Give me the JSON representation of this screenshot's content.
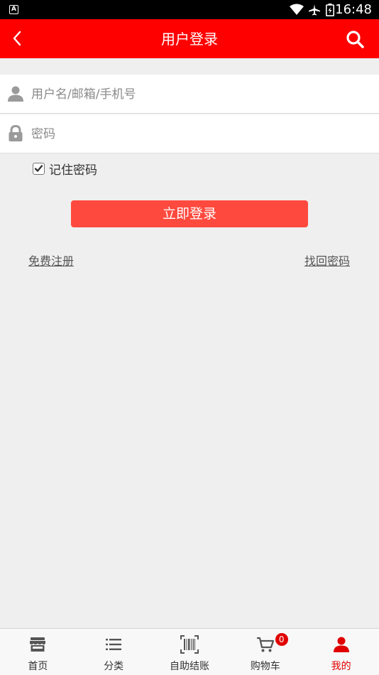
{
  "status_bar": {
    "app_badge": "A",
    "time": "16:48"
  },
  "header": {
    "title": "用户登录",
    "back_icon": "chevron-left-icon",
    "search_icon": "search-icon"
  },
  "form": {
    "username": {
      "placeholder": "用户名/邮箱/手机号",
      "value": "",
      "icon": "user-icon"
    },
    "password": {
      "placeholder": "密码",
      "value": "",
      "icon": "lock-icon"
    },
    "remember": {
      "label": "记住密码",
      "checked": true
    }
  },
  "login_button": {
    "label": "立即登录"
  },
  "links": {
    "register": "免费注册",
    "forgot": "找回密码"
  },
  "tabbar": {
    "active": "mine",
    "tabs": [
      {
        "id": "home",
        "label": "首页",
        "icon": "store-icon"
      },
      {
        "id": "category",
        "label": "分类",
        "icon": "list-icon"
      },
      {
        "id": "checkout",
        "label": "自助结账",
        "icon": "barcode-icon"
      },
      {
        "id": "cart",
        "label": "购物车",
        "icon": "cart-icon",
        "badge": "0"
      },
      {
        "id": "mine",
        "label": "我的",
        "icon": "user-icon"
      }
    ]
  },
  "colors": {
    "header_bg": "#ff0000",
    "button_bg": "#fe4a3e",
    "page_bg": "#efefef",
    "active_tab": "#e00000"
  }
}
